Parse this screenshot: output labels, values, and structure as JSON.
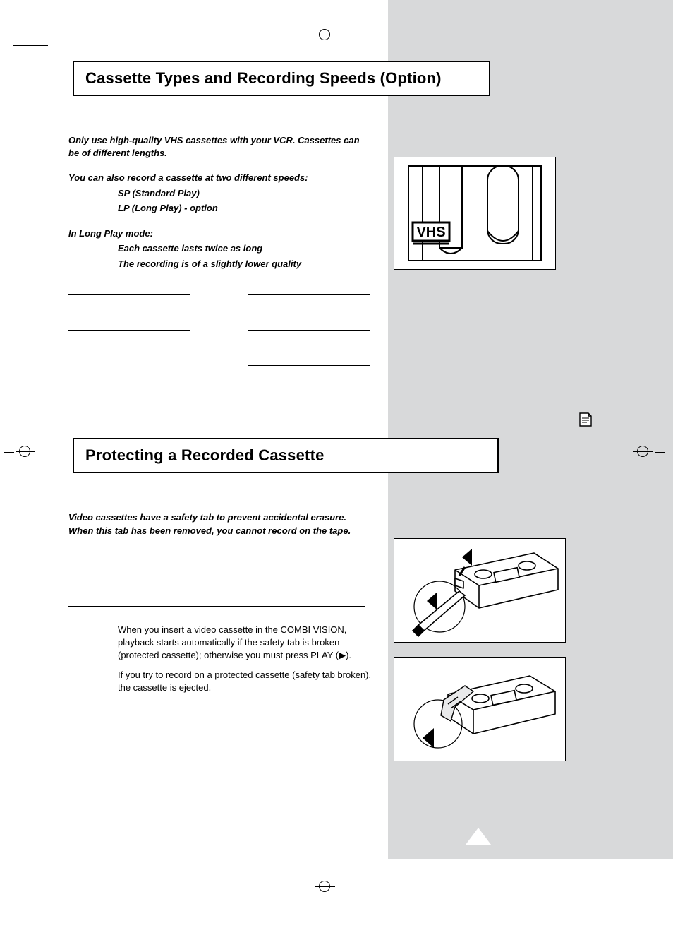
{
  "section1": {
    "title": "Cassette Types and Recording Speeds (Option)",
    "intro": "Only use high-quality VHS cassettes with your VCR. Cassettes can be of different lengths.",
    "speeds_intro": "You can also record a cassette at two different speeds:",
    "speeds": {
      "sp": "SP (Standard Play)",
      "lp": "LP (Long Play) - option"
    },
    "lp_mode_label": "In Long Play mode:",
    "lp_mode": {
      "line1": "Each cassette lasts twice as long",
      "line2": "The recording is of a slightly lower quality"
    }
  },
  "vhs_illustration_label": "VHS",
  "section2": {
    "title": "Protecting a Recorded Cassette",
    "intro_part1": "Video cassettes have a safety tab to prevent accidental erasure. When this tab has been removed, you ",
    "intro_cannot": "cannot",
    "intro_part2": " record on the tape.",
    "note1": "When you insert a video cassette in the COMBI VISION, playback starts automatically if the safety tab is broken (protected cassette); otherwise you must press PLAY (▶).",
    "note2": "If you try to record on a protected cassette (safety tab broken), the cassette is ejected."
  },
  "icons": {
    "note_tab": "note-tab-icon"
  }
}
